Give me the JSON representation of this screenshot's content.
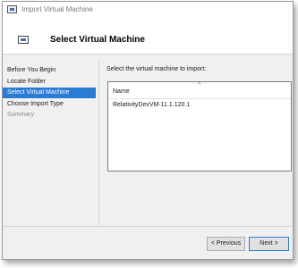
{
  "window": {
    "title": "Import Virtual Machine"
  },
  "header": {
    "title": "Select Virtual Machine"
  },
  "nav": {
    "items": [
      {
        "label": "Before You Begin",
        "state": "normal"
      },
      {
        "label": "Locate Folder",
        "state": "normal"
      },
      {
        "label": "Select Virtual Machine",
        "state": "active"
      },
      {
        "label": "Choose Import Type",
        "state": "normal"
      },
      {
        "label": "Summary",
        "state": "disabled"
      }
    ]
  },
  "main": {
    "prompt": "Select the virtual machine to import:",
    "list": {
      "column_name": "Name",
      "sort_indicator": "^",
      "rows": [
        "RelativityDevVM-11.1.120.1"
      ]
    }
  },
  "footer": {
    "previous_label": "< Previous",
    "next_label": "Next >"
  },
  "colors": {
    "accent": "#2a7bd3",
    "dialog_bg": "#f0f0f0",
    "header_bg": "#ffffff"
  }
}
